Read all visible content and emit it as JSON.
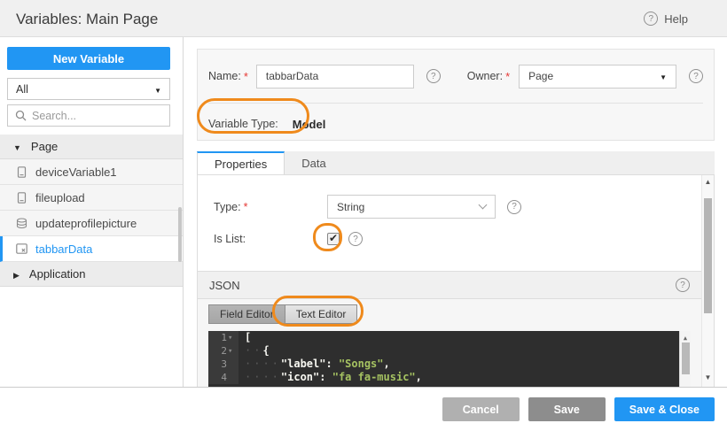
{
  "header": {
    "title": "Variables: Main Page",
    "help": "Help"
  },
  "sidebar": {
    "new_variable": "New Variable",
    "filter_selected": "All",
    "search_placeholder": "Search...",
    "groups": [
      {
        "label": "Page",
        "expanded": true,
        "items": [
          {
            "label": "deviceVariable1",
            "icon": "device-variable-icon",
            "selected": false
          },
          {
            "label": "fileupload",
            "icon": "device-variable-icon",
            "selected": false
          },
          {
            "label": "updateprofilepicture",
            "icon": "service-variable-icon",
            "selected": false
          },
          {
            "label": "tabbarData",
            "icon": "model-variable-icon",
            "selected": true
          }
        ]
      },
      {
        "label": "Application",
        "expanded": false,
        "items": []
      }
    ]
  },
  "form": {
    "name_label": "Name:",
    "required_mark": "*",
    "name_value": "tabbarData",
    "owner_label": "Owner:",
    "owner_value": "Page",
    "variable_type_label": "Variable Type:",
    "variable_type_value": "Model"
  },
  "tabs": [
    {
      "label": "Properties",
      "active": true
    },
    {
      "label": "Data",
      "active": false
    }
  ],
  "properties": {
    "type_label": "Type:",
    "type_value": "String",
    "is_list_label": "Is List:",
    "is_list_checked": true
  },
  "json_section": {
    "title": "JSON",
    "buttons": [
      {
        "label": "Field Editor",
        "active": false
      },
      {
        "label": "Text Editor",
        "active": true
      }
    ],
    "code_lines": [
      {
        "num": "1",
        "ws": "",
        "code": "["
      },
      {
        "num": "2",
        "ws": "··",
        "code": "{"
      },
      {
        "num": "3",
        "ws": "····",
        "key": "\"label\"",
        "sep": ": ",
        "str": "\"Songs\"",
        "end": ","
      },
      {
        "num": "4",
        "ws": "····",
        "key": "\"icon\"",
        "sep": ": ",
        "str": "\"fa fa-music\"",
        "end": ","
      }
    ]
  },
  "footer": {
    "cancel": "Cancel",
    "save": "Save",
    "save_close": "Save & Close"
  },
  "colors": {
    "accent": "#2196f3",
    "annotation": "#ef8a1c",
    "editor_string": "#a5c261"
  }
}
